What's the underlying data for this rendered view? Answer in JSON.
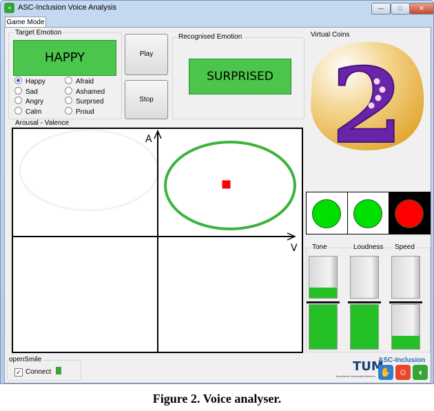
{
  "window": {
    "title": "ASC-Inclusion Voice Analysis",
    "app_icon": "sound-wave-icon",
    "controls": {
      "minimize": "—",
      "maximize": "□",
      "close": "✕"
    }
  },
  "tabs": [
    {
      "label": "Game Mode",
      "active": true
    }
  ],
  "target_emotion": {
    "group_label": "Target Emotion",
    "value": "HAPPY",
    "color": "#4bc54b",
    "options": [
      {
        "label": "Happy",
        "selected": true
      },
      {
        "label": "Sad",
        "selected": false
      },
      {
        "label": "Angry",
        "selected": false
      },
      {
        "label": "Calm",
        "selected": false
      },
      {
        "label": "Afraid",
        "selected": false
      },
      {
        "label": "Ashamed",
        "selected": false
      },
      {
        "label": "Surprsed",
        "selected": false
      },
      {
        "label": "Proud",
        "selected": false
      }
    ]
  },
  "buttons": {
    "play": "Play",
    "stop": "Stop"
  },
  "recognised_emotion": {
    "group_label": "Recognised Emotion",
    "value": "SURPRISED",
    "color": "#4bc54b"
  },
  "virtual_coins": {
    "group_label": "Virtual Coins",
    "value": "2"
  },
  "arousal_valence": {
    "group_label": "Arousal - Valence",
    "y_axis": "A",
    "x_axis": "V",
    "target_ellipse_color": "#3cb43c",
    "current_point": {
      "valence": 0.5,
      "arousal": 0.49
    },
    "point_color": "#ff0000"
  },
  "traffic_lights": [
    {
      "name": "light-1",
      "color": "#00e000",
      "bg": "#ffffff"
    },
    {
      "name": "light-2",
      "color": "#00e000",
      "bg": "#ffffff"
    },
    {
      "name": "light-3",
      "color": "#ff0000",
      "bg": "#000000"
    }
  ],
  "meters": [
    {
      "label": "Tone",
      "current": 0.25,
      "target": 1.0
    },
    {
      "label": "Loudness",
      "current": 0.0,
      "target": 1.0
    },
    {
      "label": "Speed",
      "current": 0.0,
      "target": 0.3
    }
  ],
  "opensmile": {
    "group_label": "openSmile",
    "checkbox_label": "Connect",
    "checked": true
  },
  "logos": {
    "tum": "TUM",
    "tum_subtitle": "Technische Universität München",
    "asc": "ASC-Inclusion"
  },
  "caption": "Figure 2. Voice analyser."
}
